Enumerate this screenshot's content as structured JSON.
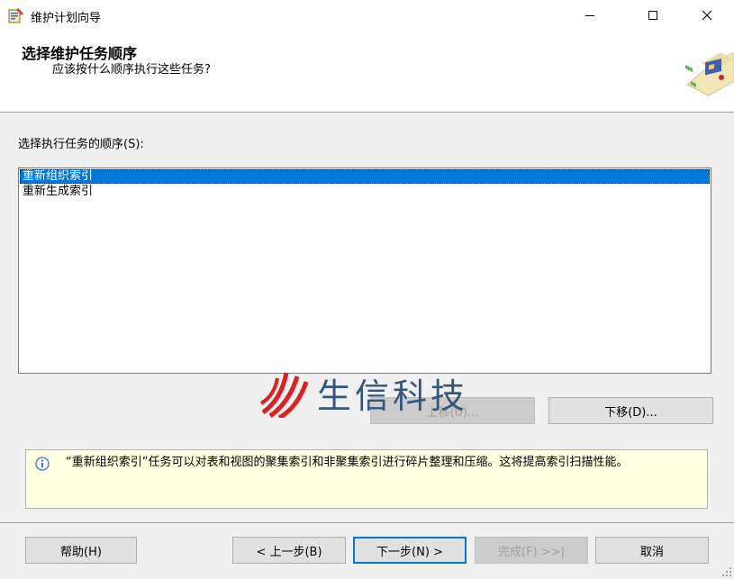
{
  "window": {
    "title": "维护计划向导",
    "app_icon": "wizard-app-icon"
  },
  "header": {
    "title": "选择维护任务顺序",
    "subtitle": "应该按什么顺序执行这些任务?",
    "graphic": "wizard-graphic"
  },
  "task_list": {
    "label": "选择执行任务的顺序(S):",
    "items": [
      {
        "label": "重新组织索引",
        "selected": true
      },
      {
        "label": "重新生成索引",
        "selected": false
      }
    ]
  },
  "move_buttons": {
    "up_label": "上移(U)...",
    "down_label": "下移(D)..."
  },
  "watermark": {
    "text": "生信科技"
  },
  "info": {
    "icon": "info-icon",
    "text": "“重新组织索引”任务可以对表和视图的聚集索引和非聚集索引进行碎片整理和压缩。这将提高索引扫描性能。"
  },
  "footer": {
    "help_label": "帮助(H)",
    "back_label": "< 上一步(B)",
    "next_label": "下一步(N) >",
    "finish_label": "完成(F) >>|",
    "cancel_label": "取消"
  },
  "colors": {
    "selection": "#0078d7",
    "info_bg": "#ffffe1",
    "watermark_red": "#e02020",
    "watermark_blue": "#34557c"
  }
}
